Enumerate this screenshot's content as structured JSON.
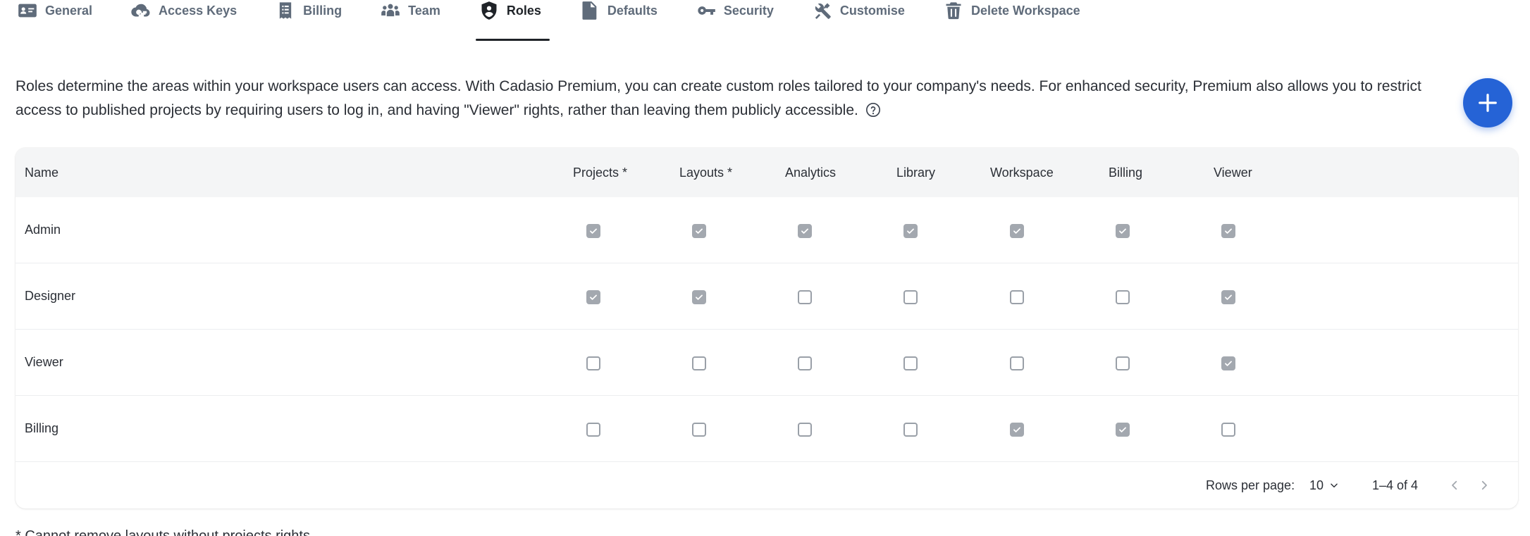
{
  "tabs": [
    {
      "label": "General",
      "icon": "id-card-icon",
      "active": false
    },
    {
      "label": "Access Keys",
      "icon": "cloud-key-icon",
      "active": false
    },
    {
      "label": "Billing",
      "icon": "receipt-icon",
      "active": false
    },
    {
      "label": "Team",
      "icon": "team-icon",
      "active": false
    },
    {
      "label": "Roles",
      "icon": "shield-user-icon",
      "active": true
    },
    {
      "label": "Defaults",
      "icon": "document-icon",
      "active": false
    },
    {
      "label": "Security",
      "icon": "key-icon",
      "active": false
    },
    {
      "label": "Customise",
      "icon": "tools-icon",
      "active": false
    },
    {
      "label": "Delete Workspace",
      "icon": "trash-icon",
      "active": false
    }
  ],
  "description": {
    "text": "Roles determine the areas within your workspace users can access. With Cadasio Premium, you can create custom roles tailored to your company's needs. For enhanced security, Premium also allows you to restrict access to published projects by requiring users to log in, and having \"Viewer\" rights, rather than leaving them publicly accessible."
  },
  "table": {
    "columns": [
      "Name",
      "Projects *",
      "Layouts *",
      "Analytics",
      "Library",
      "Workspace",
      "Billing",
      "Viewer"
    ],
    "rows": [
      {
        "name": "Admin",
        "perms": [
          true,
          true,
          true,
          true,
          true,
          true,
          true
        ]
      },
      {
        "name": "Designer",
        "perms": [
          true,
          true,
          false,
          false,
          false,
          false,
          true
        ]
      },
      {
        "name": "Viewer",
        "perms": [
          false,
          false,
          false,
          false,
          false,
          false,
          true
        ]
      },
      {
        "name": "Billing",
        "perms": [
          false,
          false,
          false,
          false,
          true,
          true,
          false
        ]
      }
    ]
  },
  "pagination": {
    "rows_per_page_label": "Rows per page:",
    "rows_per_page_value": "10",
    "range": "1–4 of 4"
  },
  "footnote": "* Cannot remove layouts without projects rights",
  "colors": {
    "accent": "#2563d6",
    "checkbox_checked": "#a3a8af",
    "tab_inactive": "#5f6b7a",
    "tab_active": "#1f2328"
  }
}
